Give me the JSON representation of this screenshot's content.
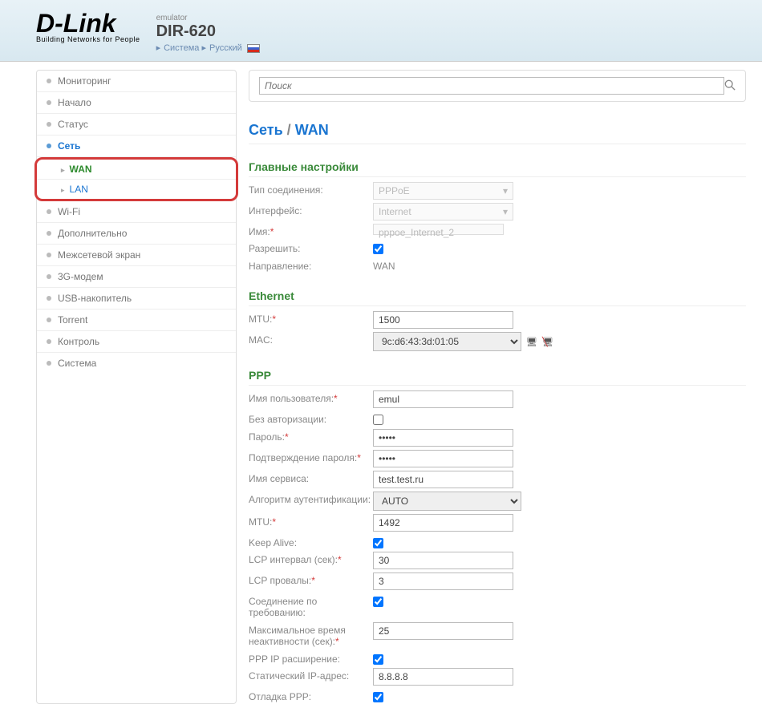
{
  "header": {
    "logo": "D-Link",
    "tagline": "Building Networks for People",
    "emulator": "emulator",
    "model": "DIR-620",
    "crumb1": "Система",
    "crumb2": "Русский"
  },
  "search": {
    "placeholder": "Поиск"
  },
  "sidebar": {
    "items": [
      "Мониторинг",
      "Начало",
      "Статус",
      "Сеть",
      "Wi-Fi",
      "Дополнительно",
      "Межсетевой экран",
      "3G-модем",
      "USB-накопитель",
      "Torrent",
      "Контроль",
      "Система"
    ],
    "sub": {
      "wan": "WAN",
      "lan": "LAN"
    }
  },
  "breadcrumb": {
    "part1": "Сеть",
    "sep": "/",
    "part2": "WAN"
  },
  "sections": {
    "main": "Главные настройки",
    "ethernet": "Ethernet",
    "ppp": "PPP"
  },
  "main_settings": {
    "conn_type_label": "Тип соединения:",
    "conn_type_value": "PPPoE",
    "interface_label": "Интерфейс:",
    "interface_value": "Internet",
    "name_label": "Имя:",
    "name_value": "pppoe_Internet_2",
    "allow_label": "Разрешить:",
    "direction_label": "Направление:",
    "direction_value": "WAN"
  },
  "ethernet": {
    "mtu_label": "MTU:",
    "mtu_value": "1500",
    "mac_label": "MAC:",
    "mac_value": "9c:d6:43:3d:01:05"
  },
  "ppp": {
    "user_label": "Имя пользователя:",
    "user_value": "emul",
    "noauth_label": "Без авторизации:",
    "pass_label": "Пароль:",
    "pass_value": "•••••",
    "pass2_label": "Подтверждение пароля:",
    "pass2_value": "•••••",
    "service_label": "Имя сервиса:",
    "service_value": "test.test.ru",
    "auth_label": "Алгоритм аутентификации:",
    "auth_value": "AUTO",
    "mtu_label": "MTU:",
    "mtu_value": "1492",
    "keepalive_label": "Keep Alive:",
    "lcp_int_label": "LCP интервал (сек):",
    "lcp_int_value": "30",
    "lcp_fail_label": "LCP провалы:",
    "lcp_fail_value": "3",
    "ondemand_label": "Соединение по требованию:",
    "idle_label": "Максимальное время неактивности (сек):",
    "idle_value": "25",
    "ipext_label": "PPP IP расширение:",
    "static_label": "Статический IP-адрес:",
    "static_value": "8.8.8.8",
    "debug_label": "Отладка PPP:"
  }
}
